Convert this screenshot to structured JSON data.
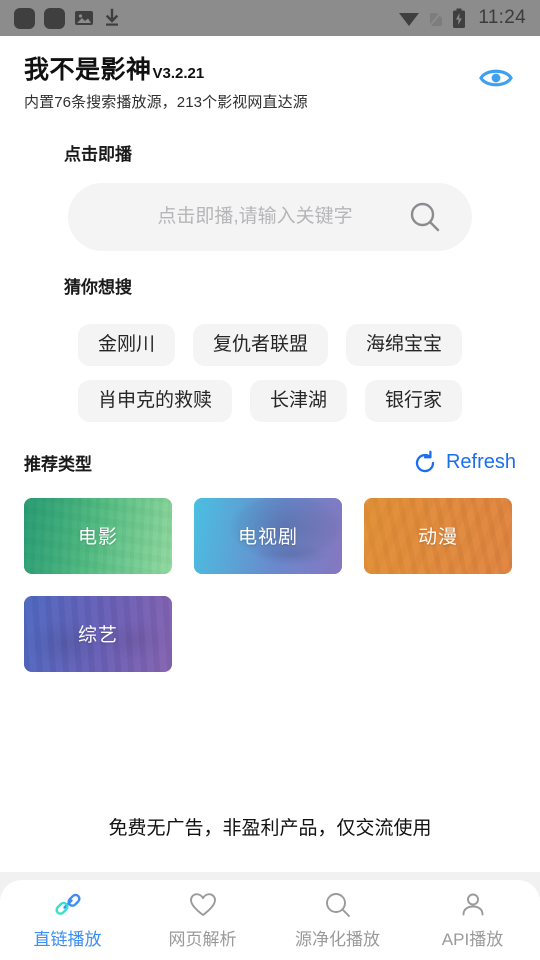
{
  "statusbar": {
    "time": "11:24",
    "left_icons": [
      "app-square-icon",
      "app-square-icon",
      "image-icon",
      "download-icon"
    ],
    "right_icons": [
      "wifi-icon",
      "no-sim-icon",
      "battery-charging-icon"
    ]
  },
  "header": {
    "title": "我不是影神",
    "version": "V3.2.21",
    "subtitle": "内置76条搜索播放源，213个影视网直达源",
    "eye_icon": "eye-icon",
    "accent": "#3fa0ef"
  },
  "play_section": {
    "title": "点击即播",
    "search_placeholder": "点击即播,请输入关键字",
    "search_value": "",
    "search_icon": "search-icon"
  },
  "guess_section": {
    "title": "猜你想搜",
    "tags": [
      "金刚川",
      "复仇者联盟",
      "海绵宝宝",
      "肖申克的救赎",
      "长津湖",
      "银行家"
    ]
  },
  "recommend_section": {
    "title": "推荐类型",
    "refresh_label": "Refresh",
    "refresh_icon": "refresh-icon",
    "refresh_color": "#1a6ef0",
    "cards": [
      {
        "label": "电影",
        "theme": "movie",
        "color": "#3cbe82"
      },
      {
        "label": "电视剧",
        "theme": "tv",
        "color": "#5f82cd"
      },
      {
        "label": "动漫",
        "theme": "anime",
        "color": "#e28232"
      },
      {
        "label": "综艺",
        "theme": "variety",
        "color": "#645cb9"
      }
    ]
  },
  "footnote": "免费无广告，非盈利产品，仅交流使用",
  "bottom_nav": {
    "active_index": 0,
    "active_color": "#3a8ef5",
    "items": [
      {
        "label": "直链播放",
        "icon": "link-icon"
      },
      {
        "label": "网页解析",
        "icon": "heart-icon"
      },
      {
        "label": "源净化播放",
        "icon": "search-icon"
      },
      {
        "label": "API播放",
        "icon": "person-icon"
      }
    ]
  }
}
